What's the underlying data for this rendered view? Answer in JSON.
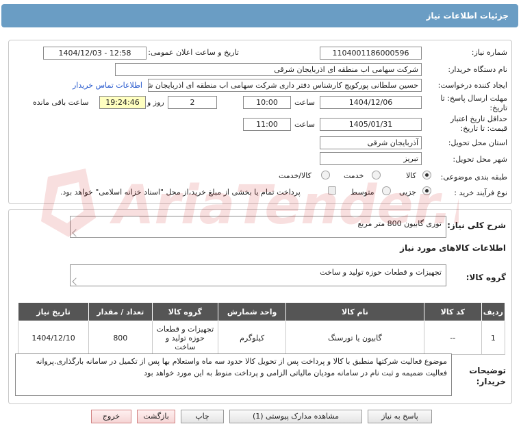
{
  "header": {
    "title": "جزئیات اطلاعات نیاز"
  },
  "info": {
    "need_number_label": "شماره نیاز:",
    "need_number": "1104001186000596",
    "announce_label": "تاریخ و ساعت اعلان عمومی:",
    "announce_value": "1404/12/03 - 12:58",
    "buyer_org_label": "نام دستگاه خریدار:",
    "buyer_org": "شرکت سهامی اب منطقه ای اذربایجان شرقی",
    "creator_label": "ایجاد کننده درخواست:",
    "creator": "حسین سلطانی پورکویج کارشناس دفتر داری شرکت سهامی اب منطقه ای اذربایجان شرقی",
    "contact_link": "اطلاعات تماس خریدار",
    "deadline_label_1": "مهلت ارسال پاسخ: تا",
    "deadline_label_2": "تاریخ:",
    "deadline_date": "1404/12/06",
    "hour_label": "ساعت",
    "deadline_time": "10:00",
    "days_value": "2",
    "days_label": "روز و",
    "remaining_time": "19:24:46",
    "remaining_label": "ساعت باقی مانده",
    "validity_label_1": "حداقل تاریخ اعتبار",
    "validity_label_2": "قیمت: تا تاریخ:",
    "validity_date": "1405/01/31",
    "validity_time": "11:00",
    "province_label": "استان محل تحویل:",
    "province": "آذربایجان شرقی",
    "city_label": "شهر محل تحویل:",
    "city": "تبریز",
    "category_label": "طبقه بندی موضوعی:",
    "category_options": [
      "کالا",
      "خدمت",
      "کالا/خدمت"
    ],
    "process_label": "نوع فرآیند خرید :",
    "process_options": [
      "جزیی",
      "متوسط"
    ],
    "payment_note": "پرداخت تمام یا بخشی از مبلغ خرید،از محل \"اسناد خزانه اسلامی\" خواهد بود."
  },
  "summary": {
    "label": "شرح کلی نیاز:",
    "text": "توری گابیون 800 متر مربع"
  },
  "goods": {
    "section_title": "اطلاعات کالاهای مورد نیاز",
    "group_label": "گروه کالا:",
    "group_value": "تجهیزات و قطعات حوزه تولید و ساخت",
    "columns": [
      "ردیف",
      "کد کالا",
      "نام کالا",
      "واحد شمارش",
      "گروه کالا",
      "تعداد / مقدار",
      "تاریخ نیاز"
    ],
    "rows": [
      {
        "row": "1",
        "code": "--",
        "name": "گابیون یا تورسنگ",
        "unit": "کیلوگرم",
        "group": "تجهیزات و قطعات حوزه تولید و ساخت",
        "qty": "800",
        "date": "1404/12/10"
      }
    ]
  },
  "notes": {
    "label_1": "توضیحات",
    "label_2": "خریدار:",
    "text": "موضوع فعالیت شرکتها منطبق با کالا و پرداخت پس از تحویل کالا حدود سه  ماه واستعلام بها پس از تکمیل در سامانه بارگذاری.پروانه فعالیت ضمیمه و ثبت نام در سامانه مودیان مالیاتی الزامی و پرداخت منوط به این مورد خواهد بود"
  },
  "buttons": {
    "reply": "پاسخ به نیاز",
    "attachments": "مشاهده مدارک پیوستی (1)",
    "print": "چاپ",
    "back": "بازگشت",
    "exit": "خروج"
  },
  "watermark": {
    "text": "AriaTender.net"
  },
  "colors": {
    "header": "#6a9dc4",
    "table_header": "#555555",
    "remaining_bg": "#ffffc0",
    "link": "#2255cc"
  }
}
